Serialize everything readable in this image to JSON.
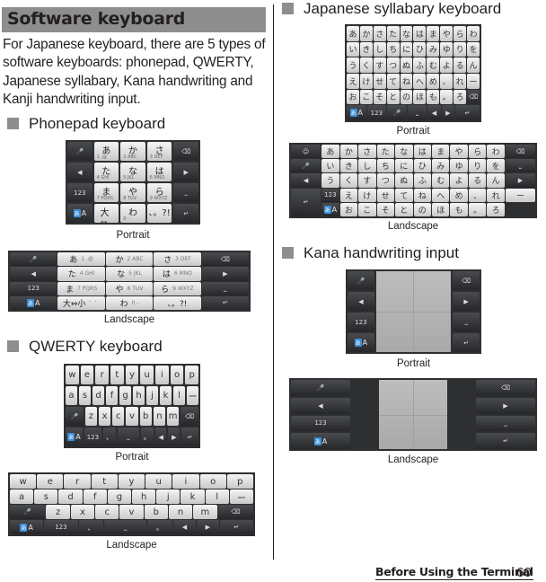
{
  "section": {
    "title": "Software keyboard",
    "intro": "For Japanese keyboard, there are 5 types of software keyboards: phonepad, QWERTY, Japanese syllabary, Kana handwriting and Kanji handwriting input."
  },
  "headings": {
    "phonepad": "Phonepad keyboard",
    "qwerty": "QWERTY keyboard",
    "syllabary": "Japanese syllabary keyboard",
    "kana": "Kana handwriting input"
  },
  "captions": {
    "portrait": "Portrait",
    "landscape": "Landscape"
  },
  "icons": {
    "mic": "🎤",
    "backspace": "⌫",
    "left": "◀",
    "right": "▶",
    "space": "⎵",
    "enter": "↵",
    "smile": "☺",
    "num": "123",
    "mode_a": "あ",
    "mode_b": "A"
  },
  "phonepad": {
    "keys": [
      {
        "kana": "あ",
        "sub": "1 .@"
      },
      {
        "kana": "か",
        "sub": "2 ABC"
      },
      {
        "kana": "さ",
        "sub": "3 DEF"
      },
      {
        "kana": "た",
        "sub": "4 GHI"
      },
      {
        "kana": "な",
        "sub": "5 JKL"
      },
      {
        "kana": "は",
        "sub": "6 MNO"
      },
      {
        "kana": "ま",
        "sub": "7 PQRS"
      },
      {
        "kana": "や",
        "sub": "8 TUV"
      },
      {
        "kana": "ら",
        "sub": "9 WXYZ"
      },
      {
        "kana": "大⇔小",
        "sub": "゛゜"
      },
      {
        "kana": "わ",
        "sub": "0 -"
      },
      {
        "kana": "、。?!",
        "sub": ""
      }
    ]
  },
  "qwerty": {
    "row1": [
      "w",
      "e",
      "r",
      "t",
      "y",
      "u",
      "i",
      "o",
      "p"
    ],
    "row2": [
      "a",
      "s",
      "d",
      "f",
      "g",
      "h",
      "j",
      "k",
      "l",
      "ー"
    ],
    "row3": [
      "z",
      "x",
      "c",
      "v",
      "b",
      "n",
      "m"
    ],
    "comma": "、",
    "period": "。"
  },
  "syllabary": {
    "rows": [
      [
        "あ",
        "か",
        "さ",
        "た",
        "な",
        "は",
        "ま",
        "や",
        "ら",
        "わ"
      ],
      [
        "い",
        "き",
        "し",
        "ち",
        "に",
        "ひ",
        "み",
        "ゆ",
        "り",
        "を"
      ],
      [
        "う",
        "く",
        "す",
        "つ",
        "ぬ",
        "ふ",
        "む",
        "よ",
        "る",
        "ん"
      ],
      [
        "え",
        "け",
        "せ",
        "て",
        "ね",
        "へ",
        "め",
        "、",
        "れ",
        "ー"
      ],
      [
        "お",
        "こ",
        "そ",
        "と",
        "の",
        "ほ",
        "も",
        "。",
        "ろ"
      ]
    ]
  },
  "footer": {
    "chapter": "Before Using the Terminal",
    "page": "60"
  }
}
